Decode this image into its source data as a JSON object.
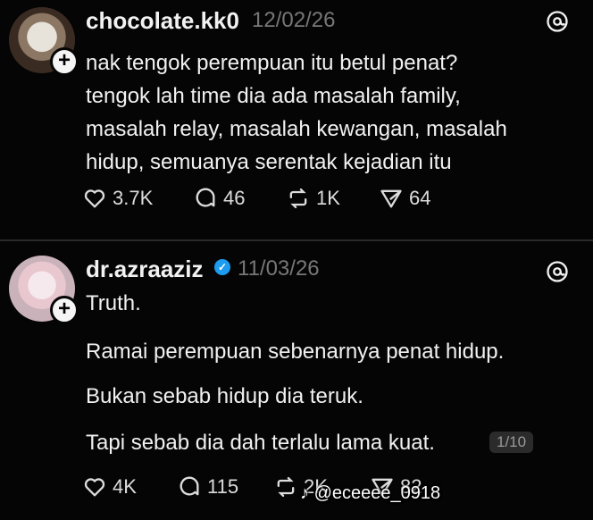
{
  "posts": [
    {
      "username": "chocolate.kk0",
      "date": "12/02/26",
      "verified": false,
      "lines": [
        "nak tengok perempuan itu betul penat?",
        "tengok lah time dia ada masalah family,",
        "masalah relay, masalah kewangan, masalah",
        "hidup, semuanya serentak kejadian itu"
      ],
      "actions": {
        "likes": "3.7K",
        "replies": "46",
        "reposts": "1K",
        "shares": "64"
      }
    },
    {
      "username": "dr.azraaziz",
      "date": "11/03/26",
      "verified": true,
      "paragraphs": [
        "Truth.",
        "Ramai perempuan sebenarnya penat hidup.",
        "Bukan sebab hidup dia teruk.",
        "Tapi sebab dia dah terlalu lama kuat."
      ],
      "page_badge": "1/10",
      "actions": {
        "likes": "4K",
        "replies": "115",
        "reposts": "2K",
        "shares": "82"
      }
    }
  ],
  "watermark": "@eceeee_0918",
  "colors": {
    "background": "#050505",
    "text": "#f3f3f3",
    "muted": "#777777",
    "verified": "#1d9bf0"
  },
  "icons": [
    "threads-icon",
    "heart-icon",
    "comment-icon",
    "repost-icon",
    "share-icon",
    "plus-icon",
    "verified-badge-icon",
    "tiktok-icon"
  ]
}
